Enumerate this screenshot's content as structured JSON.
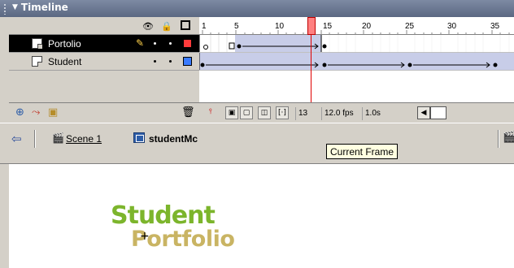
{
  "timeline": {
    "title": "Timeline",
    "header_icons": [
      "eye-icon",
      "lock-icon",
      "outline-icon"
    ],
    "ruler_ticks": [
      "1",
      "5",
      "10",
      "15",
      "20",
      "25",
      "30",
      "35"
    ],
    "layers": [
      {
        "name": "Portolio",
        "selected": true,
        "color": "#ff3b3b"
      },
      {
        "name": "Student",
        "selected": false,
        "color": "#3a7bff"
      }
    ],
    "status": {
      "current_frame": "13",
      "fps": "12.0 fps",
      "elapsed": "1.0s"
    }
  },
  "editbar": {
    "scene_label": "Scene 1",
    "symbol_label": "studentMc",
    "tooltip": "Current Frame"
  },
  "stage": {
    "logo_line1": "Student",
    "logo_line2": "Portfolio"
  },
  "colors": {
    "selected_row": "#000000",
    "playhead": "#ff8080",
    "logo_green": "#7cb52c",
    "logo_gold": "#c9b463"
  }
}
